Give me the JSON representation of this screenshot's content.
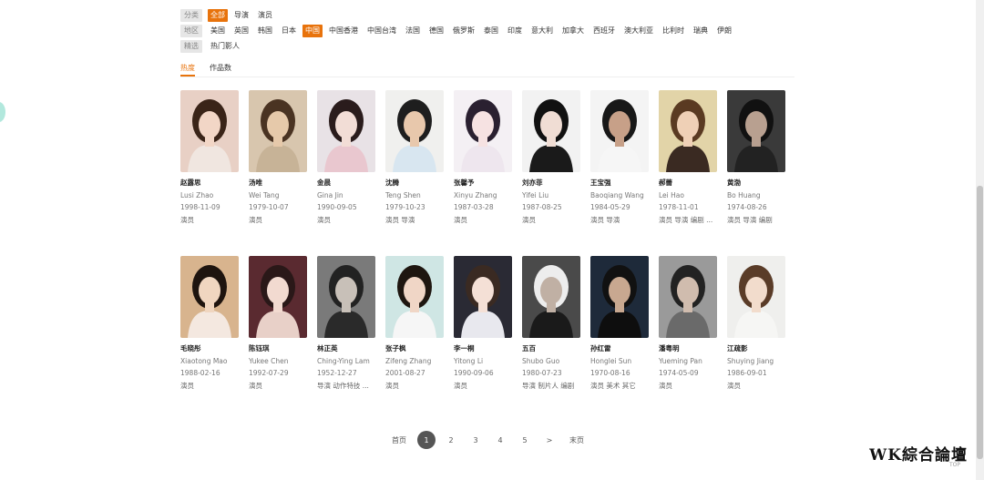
{
  "filters": {
    "category": {
      "label": "分类",
      "options": [
        "全部",
        "导演",
        "演员"
      ],
      "active": 0
    },
    "region": {
      "label": "地区",
      "options": [
        "美国",
        "英国",
        "韩国",
        "日本",
        "中国",
        "中国香港",
        "中国台湾",
        "法国",
        "德国",
        "俄罗斯",
        "泰国",
        "印度",
        "意大利",
        "加拿大",
        "西班牙",
        "澳大利亚",
        "比利时",
        "瑞典",
        "伊朗"
      ],
      "active": 4
    },
    "featured": {
      "label": "精选",
      "options": [
        "热门影人"
      ]
    }
  },
  "sort_tabs": [
    "热度",
    "作品数"
  ],
  "active_tab": 0,
  "people": [
    {
      "name": "赵露思",
      "en": "Lusi Zhao",
      "birth": "1998-11-09",
      "role": "演员",
      "bg": "#e8d0c5",
      "hair": "#3a2418",
      "skin": "#f2d6c6",
      "shirt": "#f0e6e0"
    },
    {
      "name": "汤唯",
      "en": "Wei Tang",
      "birth": "1979-10-07",
      "role": "演员",
      "bg": "#d8c6ae",
      "hair": "#4a3322",
      "skin": "#e6c9aa",
      "shirt": "#c7b397"
    },
    {
      "name": "金晨",
      "en": "Gina Jin",
      "birth": "1990-09-05",
      "role": "演员",
      "bg": "#e8e2e6",
      "hair": "#2a1c1c",
      "skin": "#f2ddd6",
      "shirt": "#e9c7cf"
    },
    {
      "name": "沈腾",
      "en": "Teng Shen",
      "birth": "1979-10-23",
      "role": "演员 导演",
      "bg": "#f0f0ee",
      "hair": "#1e1e1e",
      "skin": "#e8c8ac",
      "shirt": "#d8e6f0"
    },
    {
      "name": "张馨予",
      "en": "Xinyu Zhang",
      "birth": "1987-03-28",
      "role": "演员",
      "bg": "#f4f0f4",
      "hair": "#2a2030",
      "skin": "#f6e2e2",
      "shirt": "#eee6ee"
    },
    {
      "name": "刘亦菲",
      "en": "Yifei Liu",
      "birth": "1987-08-25",
      "role": "演员",
      "bg": "#f2f2f2",
      "hair": "#111111",
      "skin": "#f0ddd4",
      "shirt": "#1a1a1a"
    },
    {
      "name": "王宝强",
      "en": "Baoqiang Wang",
      "birth": "1984-05-29",
      "role": "演员 导演",
      "bg": "#f4f4f4",
      "hair": "#181818",
      "skin": "#c7a088",
      "shirt": "#f6f6f6"
    },
    {
      "name": "郝蕾",
      "en": "Lei Hao",
      "birth": "1978-11-01",
      "role": "演员 导演 编剧 ...",
      "bg": "#e2d4a8",
      "hair": "#5a3a22",
      "skin": "#efd0b6",
      "shirt": "#3a2a22"
    },
    {
      "name": "黄渤",
      "en": "Bo Huang",
      "birth": "1974-08-26",
      "role": "演员 导演 编剧",
      "bg": "#3a3a3a",
      "hair": "#111111",
      "skin": "#b8a090",
      "shirt": "#222222"
    },
    {
      "name": "毛晓彤",
      "en": "Xiaotong Mao",
      "birth": "1988-02-16",
      "role": "演员",
      "bg": "#d8b48e",
      "hair": "#1e140e",
      "skin": "#f0d6c0",
      "shirt": "#f4e8e0"
    },
    {
      "name": "陈钰琪",
      "en": "Yukee Chen",
      "birth": "1992-07-29",
      "role": "演员",
      "bg": "#5a2a30",
      "hair": "#2a1818",
      "skin": "#f2dad0",
      "shirt": "#e8d0c8"
    },
    {
      "name": "林正英",
      "en": "Ching-Ying Lam",
      "birth": "1952-12-27",
      "role": "导演 动作特技 ...",
      "bg": "#7a7a7a",
      "hair": "#222222",
      "skin": "#c8c0b8",
      "shirt": "#2a2a2a"
    },
    {
      "name": "张子枫",
      "en": "Zifeng Zhang",
      "birth": "2001-08-27",
      "role": "演员",
      "bg": "#cfe6e4",
      "hair": "#1e1610",
      "skin": "#f0d6c6",
      "shirt": "#f6f6f6"
    },
    {
      "name": "李一桐",
      "en": "Yitong Li",
      "birth": "1990-09-06",
      "role": "演员",
      "bg": "#2a2a34",
      "hair": "#3a2a22",
      "skin": "#f4e0d6",
      "shirt": "#e8e8ee"
    },
    {
      "name": "五百",
      "en": "Shubo Guo",
      "birth": "1980-07-23",
      "role": "导演 制片人 编剧",
      "bg": "#4a4a4a",
      "hair": "#ededed",
      "skin": "#c0b0a4",
      "shirt": "#1a1a1a"
    },
    {
      "name": "孙红雷",
      "en": "Honglei Sun",
      "birth": "1970-08-16",
      "role": "演员 美术 其它",
      "bg": "#1e2a3a",
      "hair": "#111111",
      "skin": "#c8a890",
      "shirt": "#0e0e0e"
    },
    {
      "name": "潘粤明",
      "en": "Yueming Pan",
      "birth": "1974-05-09",
      "role": "演员",
      "bg": "#9a9a9a",
      "hair": "#222222",
      "skin": "#d0bcae",
      "shirt": "#6a6a6a"
    },
    {
      "name": "江疏影",
      "en": "Shuying Jiang",
      "birth": "1986-09-01",
      "role": "演员",
      "bg": "#efefed",
      "hair": "#5a3c28",
      "skin": "#f2dccc",
      "shirt": "#f6f6f4"
    }
  ],
  "pagination": {
    "first": "首页",
    "pages": [
      "1",
      "2",
      "3",
      "4",
      "5"
    ],
    "active": 0,
    "next": ">",
    "last": "末页"
  },
  "watermark": "WK綜合論壇",
  "top_link": "TOP",
  "accent": "#e8730c"
}
